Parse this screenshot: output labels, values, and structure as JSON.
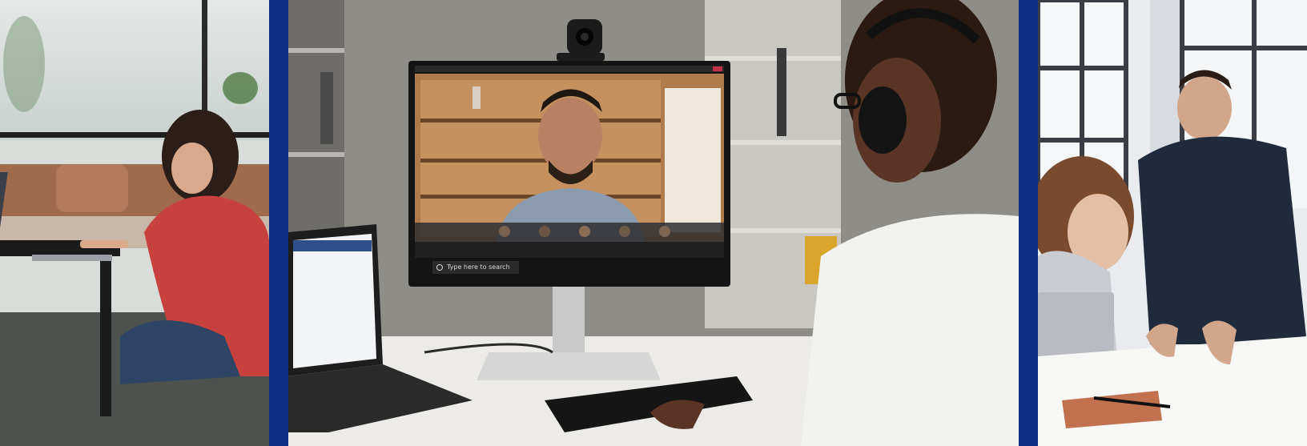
{
  "scene": {
    "left_panel": "Woman sitting on the floor typing on a laptop at a coffee table by a window",
    "middle_panel": "Person wearing headphones on a video call using a monitor with webcam, laptop and keyboard",
    "right_panel": "Two colleagues reviewing documents at a table next to a laptop"
  },
  "monitor": {
    "search_placeholder": "Type here to search"
  },
  "colors": {
    "divider": "#0c2f86",
    "frame": "#0d3388"
  }
}
